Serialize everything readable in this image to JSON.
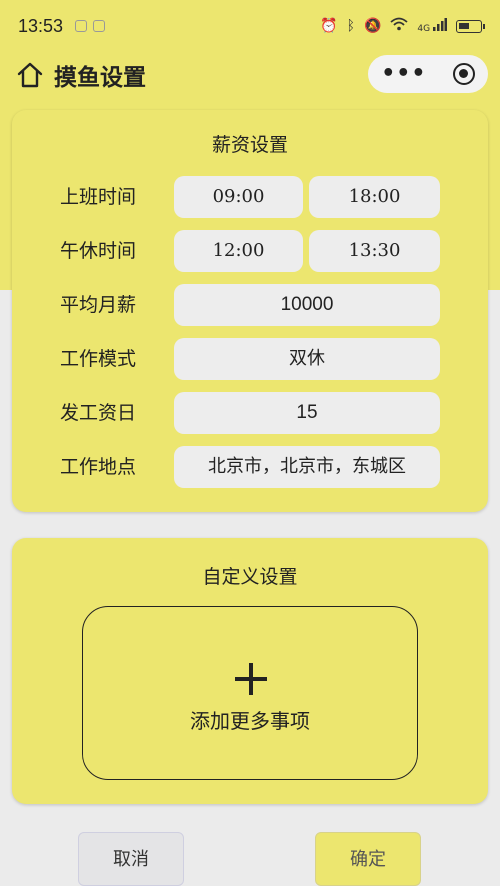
{
  "status_bar": {
    "time": "13:53",
    "network": "4G"
  },
  "nav": {
    "title": "摸鱼设置",
    "more_icon": "•••",
    "home_icon": "home-icon",
    "target_icon": "target-icon"
  },
  "salary_card": {
    "title": "薪资设置",
    "work_time": {
      "label": "上班时间",
      "start": "09:00",
      "end": "18:00"
    },
    "lunch_time": {
      "label": "午休时间",
      "start": "12:00",
      "end": "13:30"
    },
    "monthly_salary": {
      "label": "平均月薪",
      "value": "10000"
    },
    "work_mode": {
      "label": "工作模式",
      "value": "双休"
    },
    "pay_day": {
      "label": "发工资日",
      "value": "15"
    },
    "work_location": {
      "label": "工作地点",
      "value": "北京市，北京市，东城区"
    }
  },
  "custom_card": {
    "title": "自定义设置",
    "add_label": "添加更多事项"
  },
  "buttons": {
    "cancel": "取消",
    "confirm": "确定"
  },
  "colors": {
    "accent_yellow": "#ece66f",
    "page_bg": "#ebebeb",
    "pill_bg": "#ededed"
  }
}
